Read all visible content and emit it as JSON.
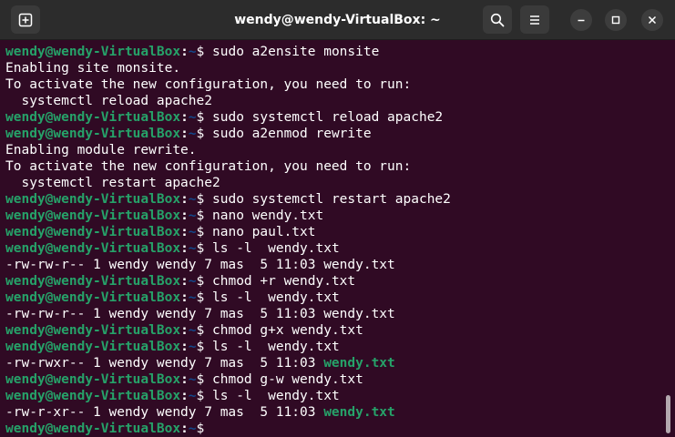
{
  "window": {
    "title": "wendy@wendy-VirtualBox: ~"
  },
  "icons": {
    "new_tab": "new-tab-icon",
    "search": "search-icon",
    "menu": "hamburger-menu-icon",
    "minimize": "minimize-icon",
    "maximize": "maximize-icon",
    "close": "close-icon"
  },
  "colors": {
    "terminal_bg": "#300a24",
    "prompt_user": "#26a269",
    "prompt_path": "#12488b",
    "titlebar_bg": "#2c2c2c"
  },
  "prompt": {
    "user_host": "wendy@wendy-VirtualBox",
    "colon": ":",
    "path": "~",
    "symbol": "$ "
  },
  "terminal": {
    "lines": [
      {
        "kind": "prompt",
        "cmd": "sudo a2ensite monsite"
      },
      {
        "kind": "output",
        "text": "Enabling site monsite."
      },
      {
        "kind": "output",
        "text": "To activate the new configuration, you need to run:"
      },
      {
        "kind": "output",
        "text": "  systemctl reload apache2"
      },
      {
        "kind": "prompt",
        "cmd": "sudo systemctl reload apache2"
      },
      {
        "kind": "prompt",
        "cmd": "sudo a2enmod rewrite"
      },
      {
        "kind": "output",
        "text": "Enabling module rewrite."
      },
      {
        "kind": "output",
        "text": "To activate the new configuration, you need to run:"
      },
      {
        "kind": "output",
        "text": "  systemctl restart apache2"
      },
      {
        "kind": "prompt",
        "cmd": "sudo systemctl restart apache2"
      },
      {
        "kind": "prompt",
        "cmd": "nano wendy.txt"
      },
      {
        "kind": "prompt",
        "cmd": "nano paul.txt"
      },
      {
        "kind": "prompt",
        "cmd": "ls -l  wendy.txt"
      },
      {
        "kind": "listing",
        "text": "-rw-rw-r-- 1 wendy wendy 7 mas  5 11:03 ",
        "file": "wendy.txt",
        "executable": false
      },
      {
        "kind": "prompt",
        "cmd": "chmod +r wendy.txt"
      },
      {
        "kind": "prompt",
        "cmd": "ls -l  wendy.txt"
      },
      {
        "kind": "listing",
        "text": "-rw-rw-r-- 1 wendy wendy 7 mas  5 11:03 ",
        "file": "wendy.txt",
        "executable": false
      },
      {
        "kind": "prompt",
        "cmd": "chmod g+x wendy.txt"
      },
      {
        "kind": "prompt",
        "cmd": "ls -l  wendy.txt"
      },
      {
        "kind": "listing",
        "text": "-rw-rwxr-- 1 wendy wendy 7 mas  5 11:03 ",
        "file": "wendy.txt",
        "executable": true
      },
      {
        "kind": "prompt",
        "cmd": "chmod g-w wendy.txt"
      },
      {
        "kind": "prompt",
        "cmd": "ls -l  wendy.txt"
      },
      {
        "kind": "listing",
        "text": "-rw-r-xr-- 1 wendy wendy 7 mas  5 11:03 ",
        "file": "wendy.txt",
        "executable": true
      },
      {
        "kind": "prompt",
        "cmd": ""
      }
    ]
  }
}
